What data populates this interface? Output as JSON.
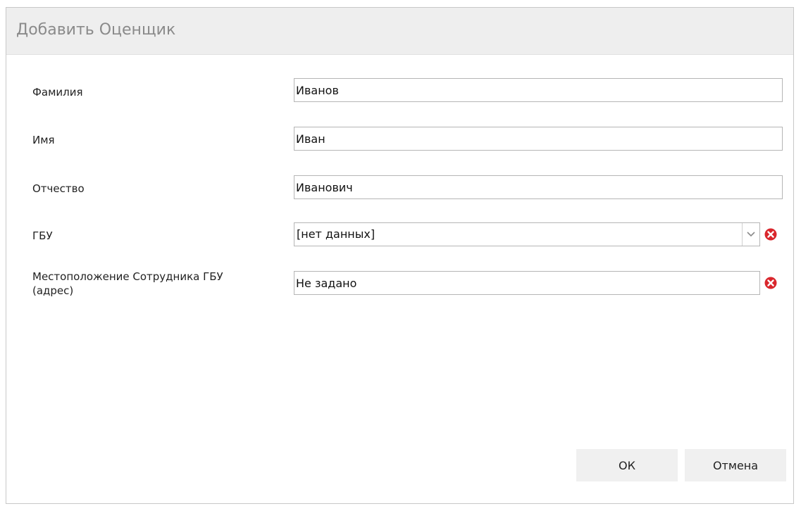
{
  "dialog": {
    "title": "Добавить Оценщик"
  },
  "form": {
    "last_name": {
      "label": "Фамилия",
      "value": "Иванов"
    },
    "first_name": {
      "label": "Имя",
      "value": "Иван"
    },
    "patronymic": {
      "label": "Отчество",
      "value": "Иванович"
    },
    "gbu": {
      "label": "ГБУ",
      "value": "[нет данных]"
    },
    "location": {
      "label_line1": "Местоположение Сотрудника ГБУ",
      "label_line2": "(адрес)",
      "value": "Не задано"
    }
  },
  "buttons": {
    "ok": "ОК",
    "cancel": "Отмена"
  },
  "colors": {
    "header_bg": "#eeeeee",
    "clear_icon": "#d9262c",
    "button_bg": "#f0f0f0"
  },
  "icons": {
    "dropdown": "chevron-down-icon",
    "clear": "clear-icon"
  }
}
